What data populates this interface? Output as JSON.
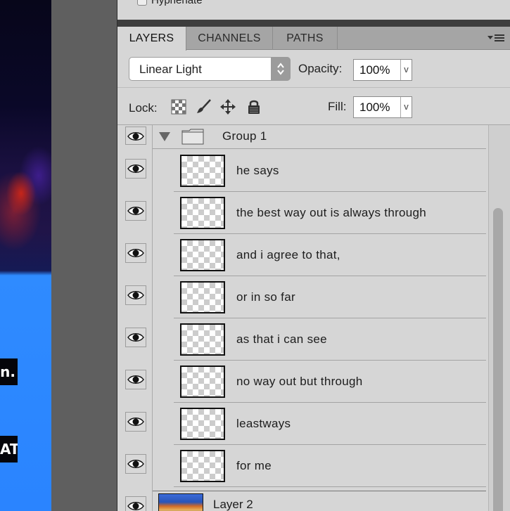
{
  "canvas": {
    "overlay_text_1": "n.",
    "overlay_text_2": "AT"
  },
  "previous_panel": {
    "checkbox_label": "Hyphenate"
  },
  "tabs": [
    {
      "label": "LAYERS",
      "active": true
    },
    {
      "label": "CHANNELS",
      "active": false
    },
    {
      "label": "PATHS",
      "active": false
    }
  ],
  "blend": {
    "mode": "Linear Light",
    "opacity_label": "Opacity:",
    "opacity_value": "100%"
  },
  "lock": {
    "label": "Lock:",
    "fill_label": "Fill:",
    "fill_value": "100%"
  },
  "group": {
    "name": "Group 1",
    "expanded": true
  },
  "layers": [
    {
      "name": "he says",
      "visible": true
    },
    {
      "name": "the best way out is always through",
      "visible": true
    },
    {
      "name": "and i agree to that,",
      "visible": true
    },
    {
      "name": "or in so far",
      "visible": true
    },
    {
      "name": "as that i can see",
      "visible": true
    },
    {
      "name": "no way out but through",
      "visible": true
    },
    {
      "name": "leastways",
      "visible": true
    },
    {
      "name": "for me",
      "visible": true
    }
  ],
  "bottom_layer": {
    "name": "Layer 2",
    "visible": true
  },
  "icons": {
    "dropdown": "v",
    "panel_menu": "▾☰"
  }
}
